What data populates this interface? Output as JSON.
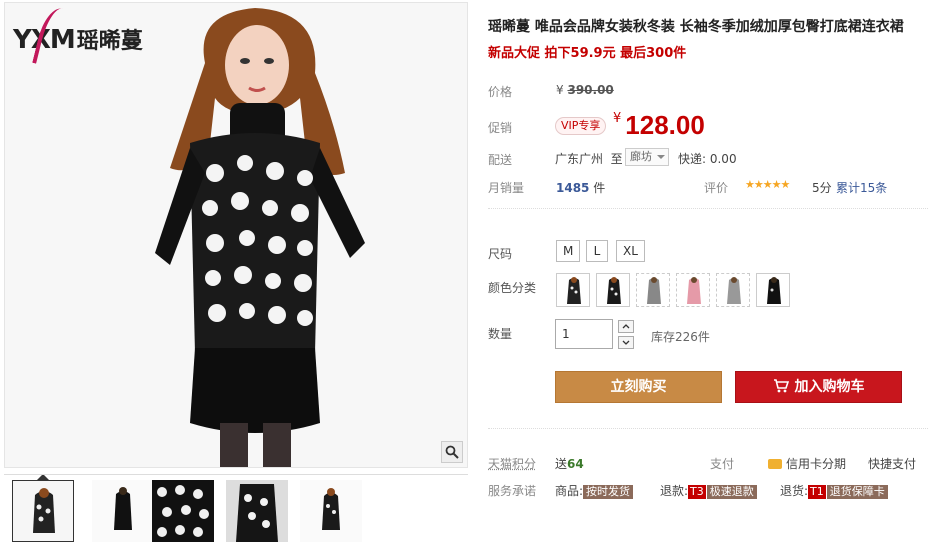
{
  "brand": {
    "logo_latin": "YXM",
    "logo_cn": "瑶晞蔓"
  },
  "product": {
    "title": "瑶晞蔓 唯品会品牌女装秋冬装 长袖冬季加绒加厚包臀打底裙连衣裙",
    "subtitle": "新品大促 拍下59.9元 最后300件"
  },
  "price": {
    "label": "价格",
    "currency": "¥",
    "original": "390.00",
    "promo_label": "促销",
    "vip_badge": "VIP专享",
    "promo": "128.00"
  },
  "shipping": {
    "label": "配送",
    "from": "广东广州",
    "to_word": "至",
    "destination": "廊坊",
    "fee": "快递: 0.00"
  },
  "sales": {
    "label": "月销量",
    "count": "1485",
    "unit": "件",
    "rating_label": "评价",
    "stars": "★★★★★",
    "score": "5分",
    "reviews": "累计15条"
  },
  "options": {
    "size_label": "尺码",
    "sizes": [
      "M",
      "L",
      "XL"
    ],
    "color_label": "颜色分类",
    "color_count": 6
  },
  "quantity": {
    "label": "数量",
    "value": "1",
    "stock": "库存226件"
  },
  "actions": {
    "buy": "立刻购买",
    "cart": "加入购物车"
  },
  "points": {
    "label": "天猫积分",
    "prefix": "送",
    "value": "64",
    "pay_label": "支付",
    "credit": "信用卡分期",
    "quick": "快捷支付"
  },
  "service": {
    "label": "服务承诺",
    "goods_label": "商品:",
    "goods_tag": "按时发货",
    "refund_label": "退款:",
    "refund_code": "T3",
    "refund_tag": "极速退款",
    "return_label": "退货:",
    "return_code": "T1",
    "return_tag": "退货保障卡"
  },
  "colors": {
    "accent_red": "#c40000",
    "buy_orange": "#c88a45",
    "cart_red": "#c8161d"
  }
}
